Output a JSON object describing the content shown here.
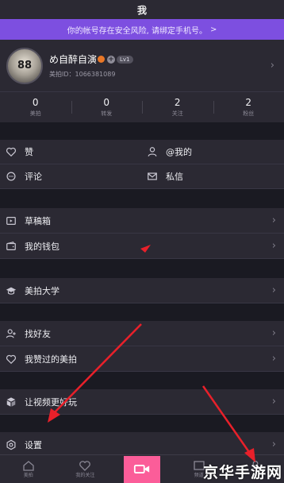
{
  "header": {
    "title": "我"
  },
  "warning": {
    "text": "你的帐号存在安全风险, 请绑定手机号。",
    "chevron": ">"
  },
  "profile": {
    "avatar_text": "88",
    "name": "め自醉自演",
    "level": "Lv1",
    "id_text": "美拍ID：1066381089"
  },
  "stats": [
    {
      "value": "0",
      "label": "美拍"
    },
    {
      "value": "0",
      "label": "转发"
    },
    {
      "value": "2",
      "label": "关注"
    },
    {
      "value": "2",
      "label": "粉丝"
    }
  ],
  "actions": {
    "like": "赞",
    "mention": "@我的",
    "comment": "评论",
    "message": "私信"
  },
  "menu": {
    "drafts": "草稿箱",
    "wallet": "我的钱包",
    "university": "美拍大学",
    "find_friends": "找好友",
    "liked": "我赞过的美拍",
    "better_video": "让视频更好玩",
    "settings": "设置"
  },
  "tabbar": {
    "home": "美拍",
    "following": "我的关注",
    "channels": "频道",
    "me": "我"
  },
  "watermark": "京华手游网",
  "colors": {
    "accent_purple": "#7d4fe0",
    "camera_pink": "#fb5d99",
    "arrow_red": "#e8202a"
  }
}
